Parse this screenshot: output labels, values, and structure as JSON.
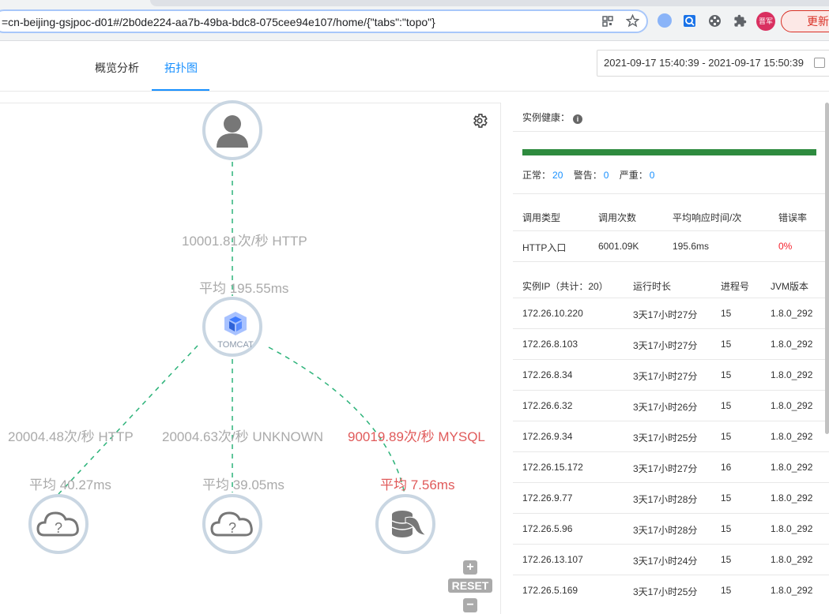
{
  "browser": {
    "url": "=cn-beijing-gsjpoc-d01#/2b0de224-aa7b-49ba-bdc8-075cee94e107/home/{\"tabs\":\"topo\"}",
    "avatar_label": "晋军",
    "update_label": "更新"
  },
  "tabs": [
    {
      "label": "概览分析",
      "active": false
    },
    {
      "label": "拓扑图",
      "active": true
    }
  ],
  "date_range": "2021-09-17 15:40:39 - 2021-09-17 15:50:39",
  "topology": {
    "nodes": [
      {
        "id": "user",
        "icon": "user-icon"
      },
      {
        "id": "tomcat",
        "icon": "tomcat-icon",
        "label": "TOMCAT"
      },
      {
        "id": "http-cloud",
        "icon": "cloud-unknown-icon"
      },
      {
        "id": "unknown-cloud",
        "icon": "cloud-unknown-icon"
      },
      {
        "id": "mysql",
        "icon": "mysql-icon"
      }
    ],
    "edges": [
      {
        "rate": "10001.81次/秒 HTTP",
        "avg": "平均 195.55ms",
        "error": false
      },
      {
        "rate": "20004.48次/秒 HTTP",
        "avg": "平均 40.27ms",
        "error": false
      },
      {
        "rate": "20004.63次/秒 UNKNOWN",
        "avg": "平均 39.05ms",
        "error": false
      },
      {
        "rate": "90019.89次/秒 MYSQL",
        "avg": "平均 7.56ms",
        "error": true
      }
    ],
    "edge_color": "#2db37a",
    "reset_label": "RESET"
  },
  "health": {
    "title": "实例健康：",
    "normal_label": "正常：",
    "normal": "20",
    "warn_label": "警告：",
    "warn": "0",
    "severe_label": "严重：",
    "severe": "0",
    "bar_color": "#2e8b3f"
  },
  "calls_table": {
    "headers": [
      "调用类型",
      "调用次数",
      "平均响应时间/次",
      "错误率"
    ],
    "rows": [
      [
        "HTTP入口",
        "6001.09K",
        "195.6ms",
        "0%"
      ]
    ]
  },
  "instances_table": {
    "headers": [
      "实例IP（共计：20）",
      "运行时长",
      "进程号",
      "JVM版本"
    ],
    "rows": [
      [
        "172.26.10.220",
        "3天17小时27分",
        "15",
        "1.8.0_292"
      ],
      [
        "172.26.8.103",
        "3天17小时27分",
        "15",
        "1.8.0_292"
      ],
      [
        "172.26.8.34",
        "3天17小时27分",
        "15",
        "1.8.0_292"
      ],
      [
        "172.26.6.32",
        "3天17小时26分",
        "15",
        "1.8.0_292"
      ],
      [
        "172.26.9.34",
        "3天17小时25分",
        "15",
        "1.8.0_292"
      ],
      [
        "172.26.15.172",
        "3天17小时27分",
        "16",
        "1.8.0_292"
      ],
      [
        "172.26.9.77",
        "3天17小时28分",
        "15",
        "1.8.0_292"
      ],
      [
        "172.26.5.96",
        "3天17小时28分",
        "15",
        "1.8.0_292"
      ],
      [
        "172.26.13.107",
        "3天17小时24分",
        "15",
        "1.8.0_292"
      ],
      [
        "172.26.5.169",
        "3天17小时25分",
        "15",
        "1.8.0_292"
      ]
    ]
  }
}
